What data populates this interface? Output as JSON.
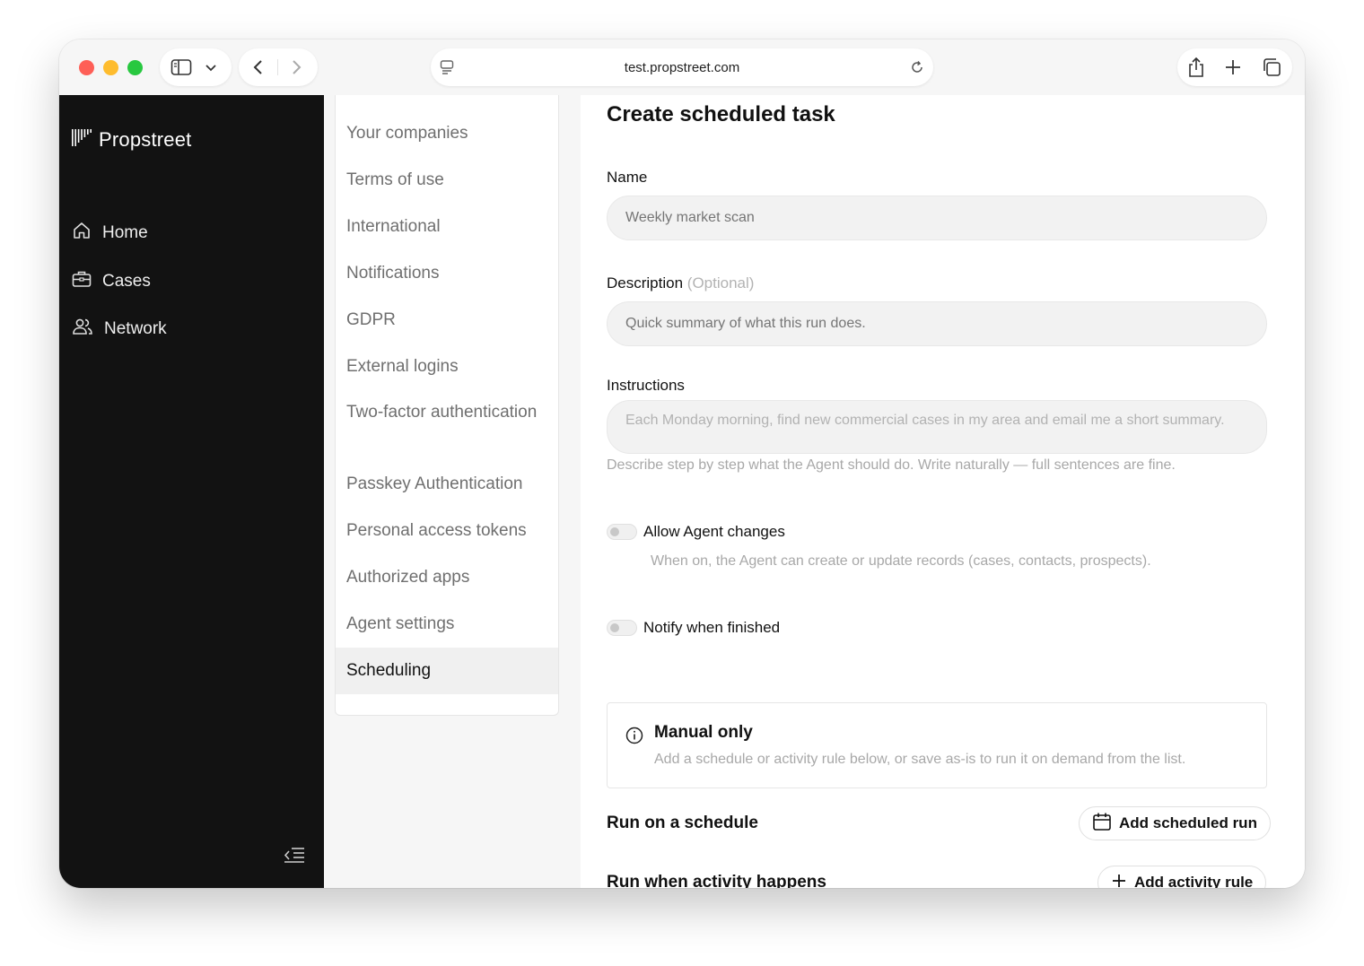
{
  "browser": {
    "url": "test.propstreet.com"
  },
  "sidebar": {
    "brand": "Propstreet",
    "items": [
      {
        "label": "Home",
        "icon": "home-icon"
      },
      {
        "label": "Cases",
        "icon": "briefcase-icon"
      },
      {
        "label": "Network",
        "icon": "people-icon"
      }
    ]
  },
  "settings_menu": {
    "items": [
      {
        "label": "Your companies"
      },
      {
        "label": "Terms of use"
      },
      {
        "label": "International"
      },
      {
        "label": "Notifications"
      },
      {
        "label": "GDPR"
      },
      {
        "label": "External logins"
      },
      {
        "label": "Two-factor authentication"
      },
      {
        "label": "Passkey Authentication"
      },
      {
        "label": "Personal access tokens"
      },
      {
        "label": "Authorized apps"
      },
      {
        "label": "Agent settings"
      },
      {
        "label": "Scheduling",
        "active": true
      }
    ]
  },
  "form": {
    "title": "Create scheduled task",
    "name_label": "Name",
    "name_placeholder": "Weekly market scan",
    "description_label": "Description",
    "description_optional": "(Optional)",
    "description_placeholder": "Quick summary of what this run does.",
    "instructions_label": "Instructions",
    "instructions_placeholder": "Each Monday morning, find new commercial cases in my area and email me a short summary.",
    "instructions_help": "Describe step by step what the Agent should do. Write naturally — full sentences are fine.",
    "allow_changes_label": "Allow Agent changes",
    "allow_changes_help": "When on, the Agent can create or update records (cases, contacts, prospects).",
    "allow_changes_on": false,
    "notify_label": "Notify when finished",
    "notify_on": false,
    "info_title": "Manual only",
    "info_desc": "Add a schedule or activity rule below, or save as-is to run it on demand from the list.",
    "schedule_title": "Run on a schedule",
    "schedule_button": "Add scheduled run",
    "activity_title": "Run when activity happens",
    "activity_button": "Add activity rule"
  }
}
